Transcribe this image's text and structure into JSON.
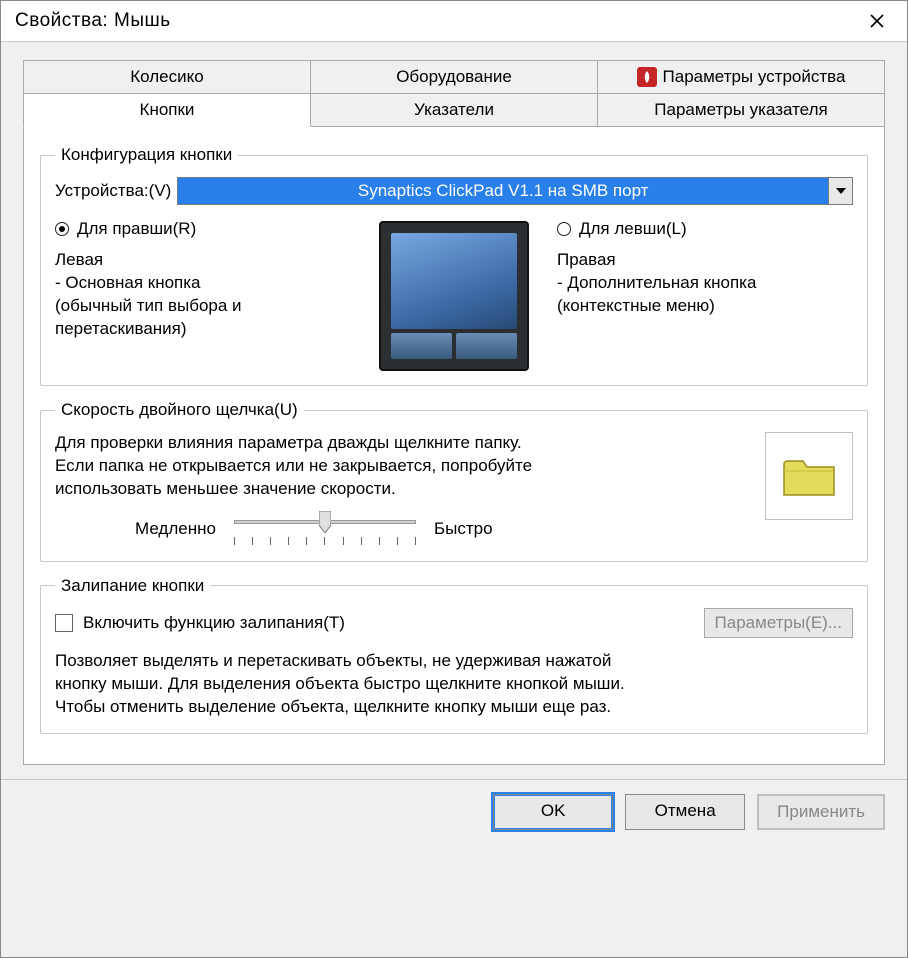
{
  "window": {
    "title": "Свойства: Мышь"
  },
  "tabs_row1": [
    {
      "label": "Колесико"
    },
    {
      "label": "Оборудование"
    },
    {
      "label": "Параметры устройства",
      "icon": true
    }
  ],
  "tabs_row2": [
    {
      "label": "Кнопки",
      "active": true
    },
    {
      "label": "Указатели"
    },
    {
      "label": "Параметры указателя"
    }
  ],
  "button_config": {
    "legend": "Конфигурация кнопки",
    "device_label": "Устройства:(V)",
    "device_value": "Synaptics ClickPad V1.1 на SMB порт",
    "right_handed": {
      "radio": "Для правши(R)",
      "title": "Левая",
      "l1": " - Основная кнопка",
      "l2": "(обычный тип выбора и",
      "l3": "перетаскивания)"
    },
    "left_handed": {
      "radio": "Для левши(L)",
      "title": "Правая",
      "l1": " - Дополнительная кнопка",
      "l2": "(контекстные меню)"
    }
  },
  "double_click": {
    "legend": "Скорость двойного щелчка(U)",
    "desc_l1": "Для проверки влияния параметра дважды щелкните папку.",
    "desc_l2": "Если папка не открывается или не закрывается, попробуйте",
    "desc_l3": "использовать меньшее значение скорости.",
    "slow": "Медленно",
    "fast": "Быстро"
  },
  "click_lock": {
    "legend": "Залипание кнопки",
    "checkbox": "Включить функцию залипания(T)",
    "params_btn": "Параметры(E)...",
    "desc_l1": "Позволяет выделять и перетаскивать объекты, не удерживая нажатой",
    "desc_l2": "кнопку мыши. Для выделения объекта быстро щелкните кнопкой мыши.",
    "desc_l3": "Чтобы отменить выделение объекта, щелкните кнопку мыши еще раз."
  },
  "buttons": {
    "ok": "OK",
    "cancel": "Отмена",
    "apply": "Применить"
  }
}
